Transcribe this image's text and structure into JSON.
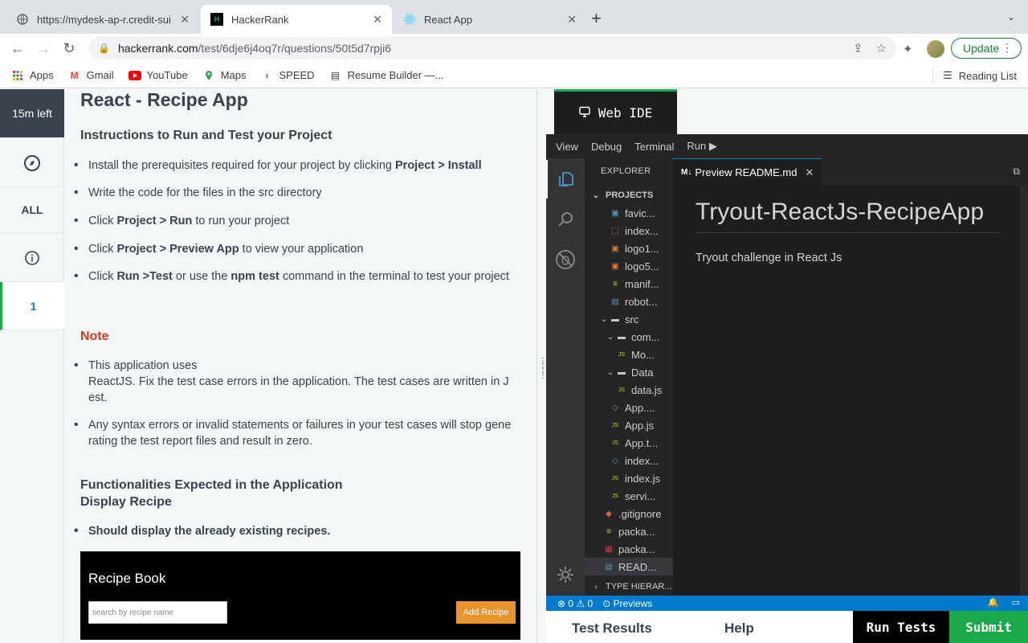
{
  "browser": {
    "tabs": [
      {
        "title": "https://mydesk-ap-r.credit-sui",
        "icon": "page-icon"
      },
      {
        "title": "HackerRank",
        "icon": "hackerrank-icon"
      },
      {
        "title": "React App",
        "icon": "react-icon"
      }
    ],
    "url_host": "hackerrank.com",
    "url_path": "/test/6dje6j4oq7r/questions/50t5d7rpji6",
    "update_label": "Update",
    "bookmarks": [
      "Apps",
      "Gmail",
      "YouTube",
      "Maps",
      "SPEED",
      "Resume Builder —..."
    ],
    "reading_list": "Reading List"
  },
  "rail": {
    "timer": "15m left",
    "all_label": "ALL",
    "question_number": "1"
  },
  "question": {
    "title": "React - Recipe App",
    "instructions_heading": "Instructions to Run and Test your Project",
    "bullets": [
      {
        "pre": "Install the prerequisites required for your project by clicking ",
        "bold": "Project > Install",
        "post": ""
      },
      {
        "pre": "Write the code for the files in the src directory",
        "bold": "",
        "post": ""
      },
      {
        "pre": "Click ",
        "bold": "Project > Run",
        "post": " to run your project"
      },
      {
        "pre": "Click ",
        "bold": "Project > Preview App",
        "post": " to view your application"
      },
      {
        "pre": "Click ",
        "bold": "Run >Test",
        "post": " or use the ",
        "bold2": "npm test",
        "post2": " command in the terminal to test your project"
      }
    ],
    "note_heading": "Note",
    "note_bullets": [
      "This application uses\nReactJS. Fix the test case errors in the application. The test cases are written in Jest.",
      "Any syntax errors or invalid statements or failures in your test cases will stop generating the test report files and result in zero."
    ],
    "functionalities_heading": "Functionalities Expected in the Application",
    "display_recipe_heading": "Display Recipe",
    "display_bullet": "Should display the already existing recipes.",
    "screenshot": {
      "title": "Recipe Book",
      "search_placeholder": "search by recipe name",
      "add_button": "Add Recipe"
    }
  },
  "ide": {
    "tab_label": "Web IDE",
    "menu": [
      "View",
      "Debug",
      "Terminal",
      "Run ▶"
    ],
    "explorer_heading": "EXPLORER",
    "projects_label": "PROJECTS",
    "files": [
      {
        "name": "favic...",
        "icon": "image-file-icon",
        "color": "#519aba"
      },
      {
        "name": "index...",
        "icon": "html-file-icon",
        "color": "#e37933"
      },
      {
        "name": "logo1...",
        "icon": "image-file-icon",
        "color": "#e37933"
      },
      {
        "name": "logo5...",
        "icon": "image-file-icon",
        "color": "#e37933"
      },
      {
        "name": "manif...",
        "icon": "json-file-icon",
        "color": "#cbcb41"
      },
      {
        "name": "robot...",
        "icon": "text-file-icon",
        "color": "#519aba"
      },
      {
        "name": "src",
        "icon": "folder-icon",
        "color": "#c5c5c5"
      },
      {
        "name": "com...",
        "icon": "folder-icon",
        "color": "#c5c5c5"
      },
      {
        "name": "Mo...",
        "icon": "js-file-icon",
        "color": "#cbcb41"
      },
      {
        "name": "Data",
        "icon": "folder-icon",
        "color": "#c5c5c5"
      },
      {
        "name": "data.js",
        "icon": "js-file-icon",
        "color": "#cbcb41"
      },
      {
        "name": "App....",
        "icon": "css-file-icon",
        "color": "#519aba"
      },
      {
        "name": "App.js",
        "icon": "js-file-icon",
        "color": "#cbcb41"
      },
      {
        "name": "App.t...",
        "icon": "js-file-icon",
        "color": "#cbcb41"
      },
      {
        "name": "index...",
        "icon": "css-file-icon",
        "color": "#519aba"
      },
      {
        "name": "index.js",
        "icon": "js-file-icon",
        "color": "#cbcb41"
      },
      {
        "name": "servi...",
        "icon": "js-file-icon",
        "color": "#cbcb41"
      },
      {
        "name": ".gitignore",
        "icon": "git-icon",
        "color": "#e05d44"
      },
      {
        "name": "packa...",
        "icon": "json-file-icon",
        "color": "#cbcb41"
      },
      {
        "name": "packa...",
        "icon": "npm-icon",
        "color": "#cb3837"
      },
      {
        "name": "READ...",
        "icon": "markdown-icon",
        "color": "#519aba"
      }
    ],
    "type_hierarchy": "TYPE HIERAR...",
    "editor_tab": "Preview README.md",
    "editor_tab_prefix": "M↓",
    "readme_title": "Tryout-ReactJs-RecipeApp",
    "readme_text": "Tryout challenge in React Js",
    "status_errors": "0",
    "status_warnings": "0",
    "status_previews": "Previews"
  },
  "bottom": {
    "test_results": "Test Results",
    "help": "Help",
    "run_tests": "Run Tests",
    "submit": "Submit"
  }
}
